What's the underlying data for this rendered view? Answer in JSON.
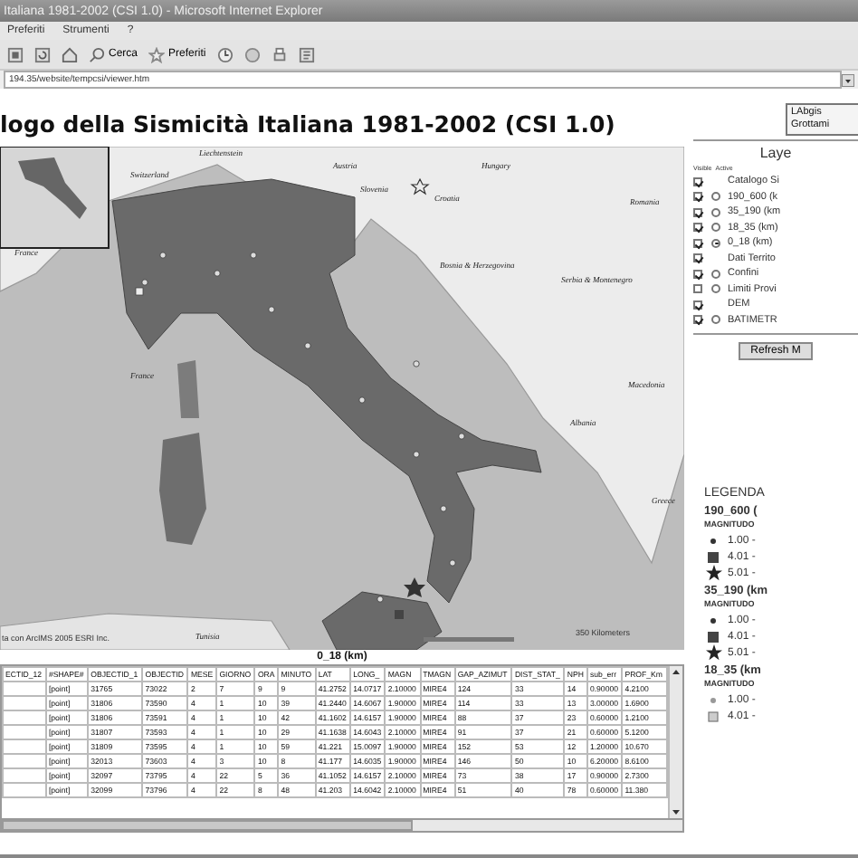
{
  "window": {
    "title": "Italiana 1981-2002 (CSI 1.0) - Microsoft Internet Explorer"
  },
  "menu": [
    "Preferiti",
    "Strumenti",
    "?"
  ],
  "toolbar": {
    "search": "Cerca",
    "favorites": "Preferiti"
  },
  "address": "194.35/website/tempcsi/viewer.htm",
  "page": {
    "heading": "logo della Sismicità Italiana 1981-2002 (CSI 1.0)",
    "logo": [
      "LAbgis",
      "Grottami"
    ]
  },
  "map": {
    "labels": [
      "Liechtenstein",
      "Switzerland",
      "Austria",
      "Slovenia",
      "Croatia",
      "Hungary",
      "Romania",
      "Bosnia & Herzegovina",
      "Serbia & Montenegro",
      "France",
      "France",
      "Macedonia",
      "Albania",
      "Greece",
      "Tunisia"
    ],
    "attribution": "ta con ArcIMS  2005 ESRI Inc.",
    "scale": "350 Kilometers"
  },
  "table": {
    "title": "0_18 (km)",
    "columns": [
      "ECTID_12",
      "#SHAPE#",
      "OBJECTID_1",
      "OBJECTID",
      "MESE",
      "GIORNO",
      "ORA",
      "MINUTO",
      "LAT",
      "LONG_",
      "MAGN",
      "TMAGN",
      "GAP_AZIMUT",
      "DIST_STAT_",
      "NPH",
      "sub_err",
      "PROF_Km"
    ],
    "rows": [
      [
        "",
        "[point]",
        "31765",
        "73022",
        "2",
        "7",
        "9",
        "9",
        "41.2752",
        "14.0717",
        "2.10000",
        "MIRE4",
        "124",
        "33",
        "14",
        "0.90000",
        "4.2100"
      ],
      [
        "",
        "[point]",
        "31806",
        "73590",
        "4",
        "1",
        "10",
        "39",
        "41.2440",
        "14.6067",
        "1.90000",
        "MIRE4",
        "114",
        "33",
        "13",
        "3.00000",
        "1.6900"
      ],
      [
        "",
        "[point]",
        "31806",
        "73591",
        "4",
        "1",
        "10",
        "42",
        "41.1602",
        "14.6157",
        "1.90000",
        "MIRE4",
        "88",
        "37",
        "23",
        "0.60000",
        "1.2100"
      ],
      [
        "",
        "[point]",
        "31807",
        "73593",
        "4",
        "1",
        "10",
        "29",
        "41.1638",
        "14.6043",
        "2.10000",
        "MIRE4",
        "91",
        "37",
        "21",
        "0.60000",
        "5.1200"
      ],
      [
        "",
        "[point]",
        "31809",
        "73595",
        "4",
        "1",
        "10",
        "59",
        "41.221",
        "15.0097",
        "1.90000",
        "MIRE4",
        "152",
        "53",
        "12",
        "1.20000",
        "10.670"
      ],
      [
        "",
        "[point]",
        "32013",
        "73603",
        "4",
        "3",
        "10",
        "8",
        "41.177",
        "14.6035",
        "1.90000",
        "MIRE4",
        "146",
        "50",
        "10",
        "6.20000",
        "8.6100"
      ],
      [
        "",
        "[point]",
        "32097",
        "73795",
        "4",
        "22",
        "5",
        "36",
        "41.1052",
        "14.6157",
        "2.10000",
        "MIRE4",
        "73",
        "38",
        "17",
        "0.90000",
        "2.7300"
      ],
      [
        "",
        "[point]",
        "32099",
        "73796",
        "4",
        "22",
        "8",
        "48",
        "41.203",
        "14.6042",
        "2.10000",
        "MIRE4",
        "51",
        "40",
        "78",
        "0.60000",
        "11.380"
      ]
    ]
  },
  "layers": {
    "title": "Laye",
    "headers": [
      "Visible",
      "Active"
    ],
    "items": [
      {
        "label": "Catalogo Si",
        "visible": true,
        "kind": "plain"
      },
      {
        "label": "190_600 (k",
        "visible": true,
        "kind": "radio",
        "selected": false
      },
      {
        "label": "35_190 (km",
        "visible": true,
        "kind": "radio",
        "selected": false
      },
      {
        "label": "18_35 (km)",
        "visible": true,
        "kind": "radio",
        "selected": false
      },
      {
        "label": "0_18 (km)",
        "visible": true,
        "kind": "radio",
        "selected": true
      },
      {
        "label": "Dati Territo",
        "visible": true,
        "kind": "plain"
      },
      {
        "label": "Confini",
        "visible": true,
        "kind": "radio",
        "selected": false
      },
      {
        "label": "Limiti Provi",
        "visible": false,
        "kind": "radio",
        "selected": false
      },
      {
        "label": "DEM",
        "visible": true,
        "kind": "plain"
      },
      {
        "label": "BATIMETR",
        "visible": true,
        "kind": "radio",
        "selected": false
      }
    ],
    "button": "Refresh M"
  },
  "legend": {
    "title": "LEGENDA",
    "groups": [
      {
        "name": "190_600 (",
        "field": "MAGNITUDO",
        "entries": [
          {
            "kind": "dot",
            "text": "1.00 -"
          },
          {
            "kind": "square",
            "text": "4.01 -"
          },
          {
            "kind": "star",
            "text": "5.01 -"
          }
        ]
      },
      {
        "name": "35_190 (km",
        "field": "MAGNITUDO",
        "entries": [
          {
            "kind": "dot",
            "text": "1.00 -"
          },
          {
            "kind": "square",
            "text": "4.01 -"
          },
          {
            "kind": "star",
            "text": "5.01 -"
          }
        ]
      },
      {
        "name": "18_35 (km",
        "field": "MAGNITUDO",
        "entries": [
          {
            "kind": "dot-light",
            "text": "1.00 -"
          },
          {
            "kind": "square-light",
            "text": "4.01 -"
          }
        ]
      }
    ]
  }
}
